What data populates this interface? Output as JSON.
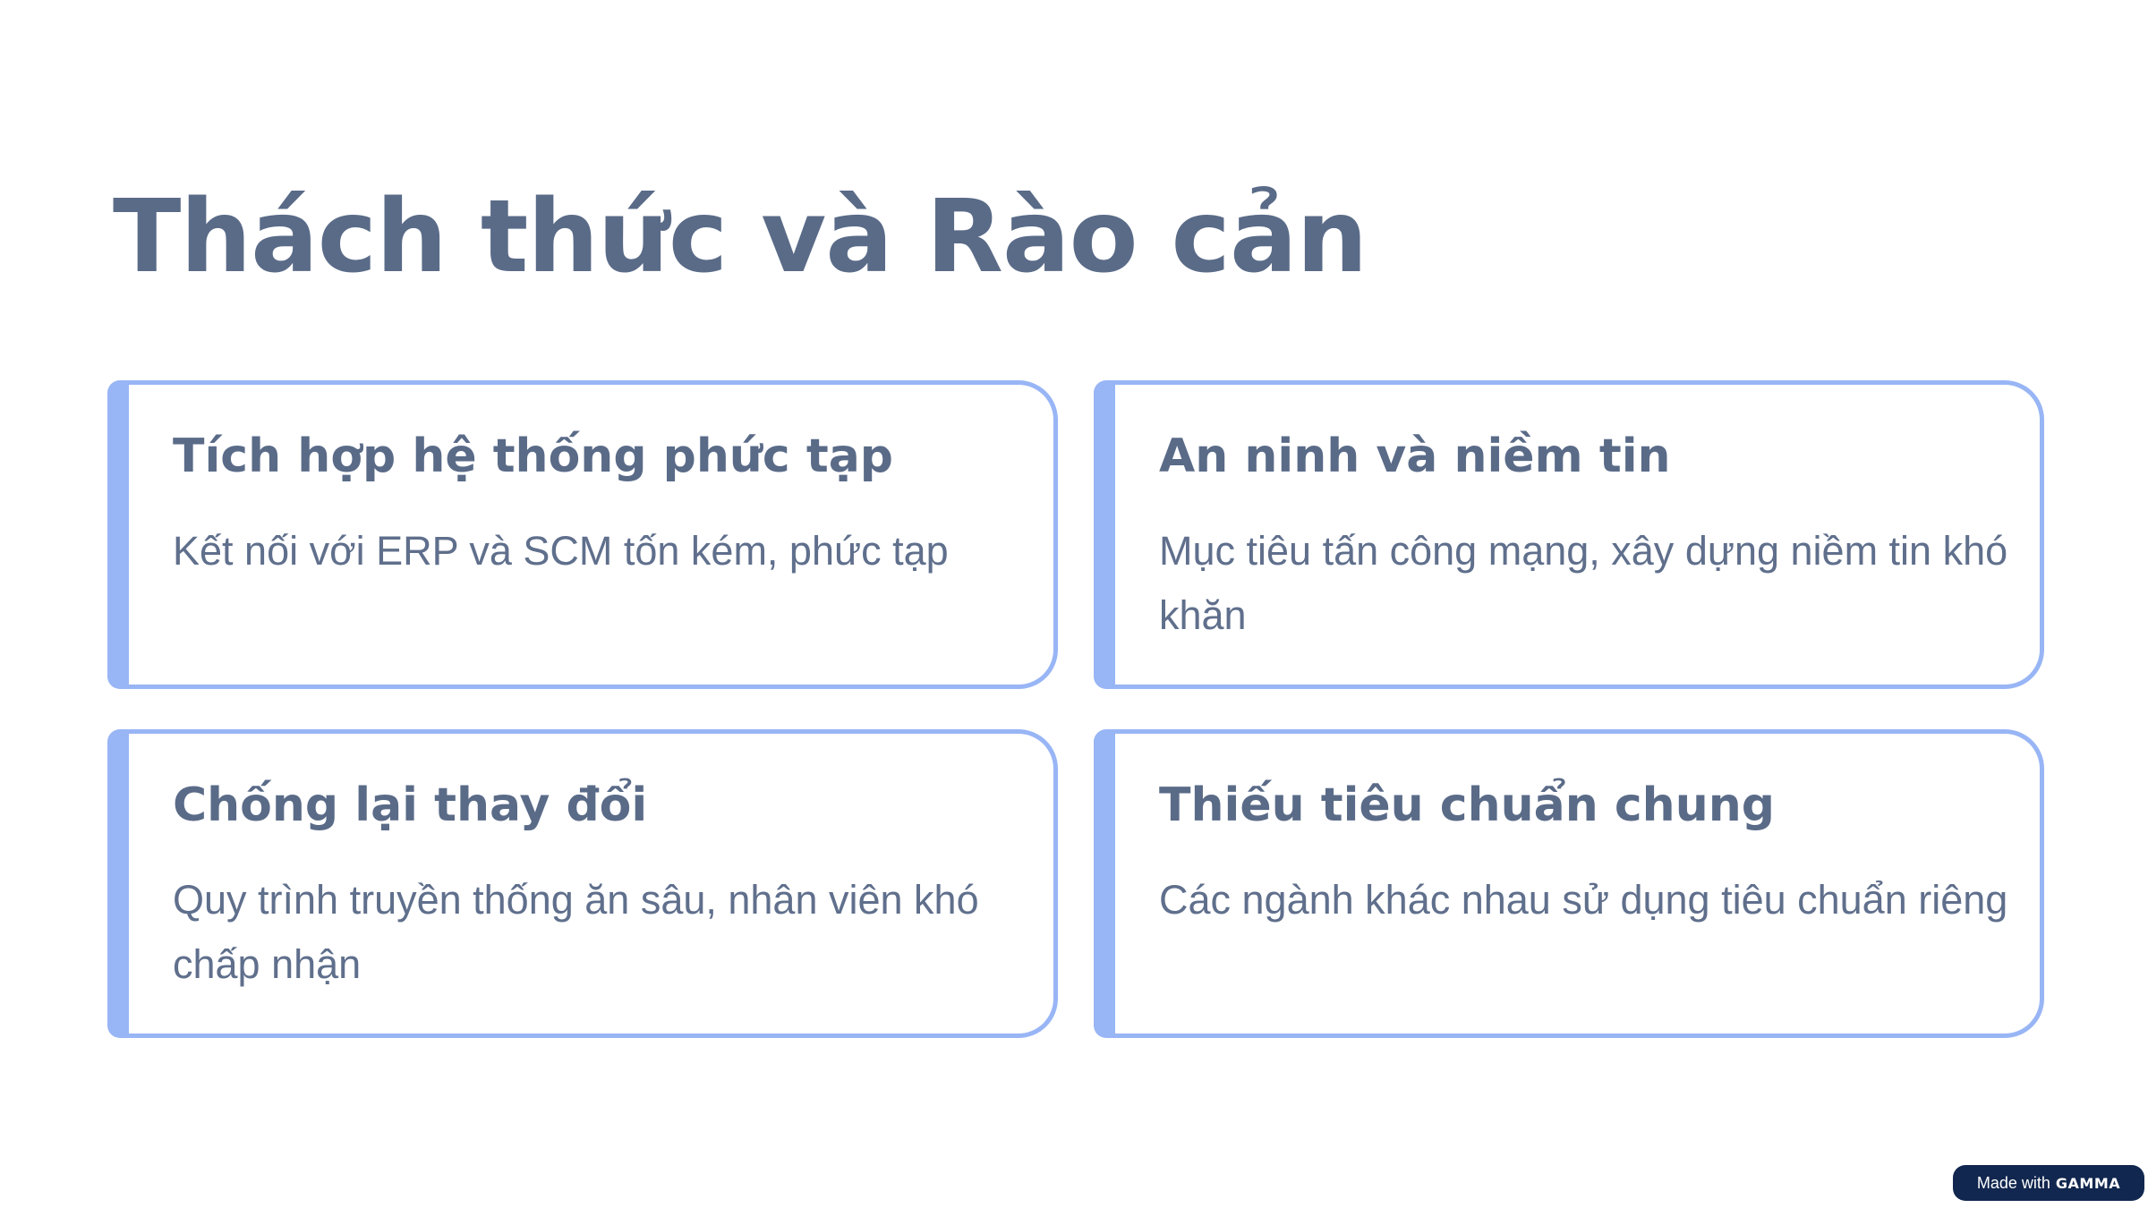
{
  "slide": {
    "title": "Thách thức và Rào cản",
    "cards": [
      {
        "title": "Tích hợp hệ thống phức tạp",
        "body": "Kết nối với ERP và SCM tốn kém, phức tạp"
      },
      {
        "title": "An ninh và niềm tin",
        "body": "Mục tiêu tấn công mạng, xây dựng niềm tin khó khăn"
      },
      {
        "title": "Chống lại thay đổi",
        "body": "Quy trình truyền thống ăn sâu, nhân viên khó chấp nhận"
      },
      {
        "title": "Thiếu tiêu chuẩn chung",
        "body": "Các ngành khác nhau sử dụng tiêu chuẩn riêng"
      }
    ]
  },
  "badge": {
    "prefix": "Made with",
    "brand": "GAMMA"
  },
  "colors": {
    "heading": "#5a6b88",
    "body_text": "#5f6f8c",
    "card_accent": "#98b5f5",
    "badge_background": "#12274f",
    "background": "#ffffff"
  }
}
